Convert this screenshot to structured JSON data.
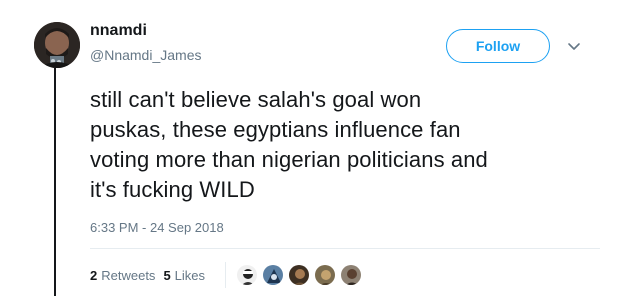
{
  "user": {
    "name": "nnamdi",
    "handle": "@Nnamdi_James"
  },
  "follow_label": "Follow",
  "tweet": {
    "lines": [
      "still can't believe salah's goal won",
      "puskas, these egyptians influence fan",
      "voting more than nigerian politicians and",
      "it's fucking WILD"
    ],
    "timestamp": "6:33 PM - 24 Sep 2018"
  },
  "stats": {
    "retweets_count": "2",
    "retweets_label": "Retweets",
    "likes_count": "5",
    "likes_label": "Likes"
  },
  "icons": {
    "more_menu": "chevron-down-icon"
  },
  "colors": {
    "accent": "#1da1f2",
    "text": "#14171a",
    "secondary": "#657786",
    "divider": "#e6ecf0"
  }
}
